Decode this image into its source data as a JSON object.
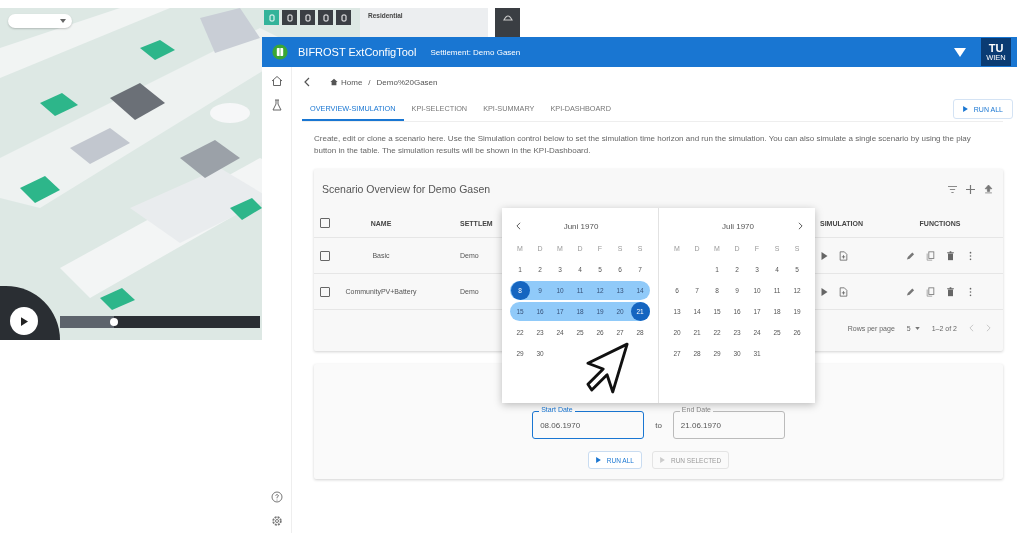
{
  "map": {
    "tools": [
      {
        "selected": true
      },
      {
        "selected": false
      },
      {
        "selected": false
      },
      {
        "selected": false
      },
      {
        "selected": false
      }
    ],
    "panel_title": "Residential",
    "timeline": {
      "level": 0.27
    }
  },
  "app": {
    "title": "BIFROST ExtConfigTool",
    "subtitle": "Settlement: Demo Gasen",
    "logo": {
      "top": "TU",
      "bottom": "WIEN"
    }
  },
  "breadcrumb": {
    "home": "Home",
    "separator": "/",
    "current": "Demo%20Gasen"
  },
  "tabs": [
    {
      "label": "OVERVIEW-SIMULATION",
      "selected": true
    },
    {
      "label": "KPI-SELECTION",
      "selected": false
    },
    {
      "label": "KPI-SUMMARY",
      "selected": false
    },
    {
      "label": "KPI-DASHBOARD",
      "selected": false
    }
  ],
  "run_all_button": "RUN ALL",
  "description": "Create, edit or clone a scenario here. Use the Simulation control below to set the simulation time horizon and run the simulation. You can also simulate a single scenario by using the play button in the table. The simulation results will be shown in the KPI-Dashboard.",
  "scenario_table": {
    "title": "Scenario Overview for Demo Gasen",
    "header_checked": false,
    "columns": [
      "NAME",
      "SETTLEM",
      "SIMULATION",
      "FUNCTIONS"
    ],
    "rows": [
      {
        "checked": false,
        "name": "Basic",
        "settlement": "Demo"
      },
      {
        "checked": false,
        "name": "CommunityPV+Battery",
        "settlement": "Demo"
      }
    ],
    "rows_per_page_label": "Rows per page",
    "rows_per_page": "5",
    "range": "1–2 of 2"
  },
  "simulation": {
    "start_date": {
      "label": "Start Date",
      "value": "08.06.1970",
      "focused": true
    },
    "separator": "to",
    "end_date": {
      "label": "End Date",
      "value": "21.06.1970",
      "focused": false
    },
    "buttons": [
      {
        "label": "RUN ALL",
        "disabled": false
      },
      {
        "label": "RUN SELECTED",
        "disabled": true
      }
    ]
  },
  "calendar": {
    "months": [
      {
        "title": "Juni 1970",
        "weekdays": [
          "M",
          "D",
          "M",
          "D",
          "F",
          "S",
          "S"
        ],
        "weeks": [
          {
            "days": [
              {
                "day": "1",
                "selected": false,
                "endpoint": false
              },
              {
                "day": "2",
                "selected": false,
                "endpoint": false
              },
              {
                "day": "3",
                "selected": false,
                "endpoint": false
              },
              {
                "day": "4",
                "selected": false,
                "endpoint": false
              },
              {
                "day": "5",
                "selected": false,
                "endpoint": false
              },
              {
                "day": "6",
                "selected": false,
                "endpoint": false
              },
              {
                "day": "7",
                "selected": false,
                "endpoint": false
              }
            ]
          },
          {
            "days": [
              {
                "day": "8",
                "selected": true,
                "endpoint": true
              },
              {
                "day": "9",
                "selected": true,
                "endpoint": false
              },
              {
                "day": "10",
                "selected": true,
                "endpoint": false
              },
              {
                "day": "11",
                "selected": true,
                "endpoint": false
              },
              {
                "day": "12",
                "selected": true,
                "endpoint": false
              },
              {
                "day": "13",
                "selected": true,
                "endpoint": false
              },
              {
                "day": "14",
                "selected": true,
                "endpoint": false
              }
            ]
          },
          {
            "days": [
              {
                "day": "15",
                "selected": true,
                "endpoint": false
              },
              {
                "day": "16",
                "selected": true,
                "endpoint": false
              },
              {
                "day": "17",
                "selected": true,
                "endpoint": false
              },
              {
                "day": "18",
                "selected": true,
                "endpoint": false
              },
              {
                "day": "19",
                "selected": true,
                "endpoint": false
              },
              {
                "day": "20",
                "selected": true,
                "endpoint": false
              },
              {
                "day": "21",
                "selected": true,
                "endpoint": true
              }
            ]
          },
          {
            "days": [
              {
                "day": "22",
                "selected": false,
                "endpoint": false
              },
              {
                "day": "23",
                "selected": false,
                "endpoint": false
              },
              {
                "day": "24",
                "selected": false,
                "endpoint": false
              },
              {
                "day": "25",
                "selected": false,
                "endpoint": false
              },
              {
                "day": "26",
                "selected": false,
                "endpoint": false
              },
              {
                "day": "27",
                "selected": false,
                "endpoint": false
              },
              {
                "day": "28",
                "selected": false,
                "endpoint": false
              }
            ]
          },
          {
            "days": [
              {
                "day": "29",
                "selected": false,
                "endpoint": false
              },
              {
                "day": "30",
                "selected": false,
                "endpoint": false
              }
            ]
          }
        ]
      },
      {
        "title": "Juli 1970",
        "weekdays": [
          "M",
          "D",
          "M",
          "D",
          "F",
          "S",
          "S"
        ],
        "weeks": [
          {
            "days": [
              {
                "day": "1",
                "selected": false,
                "endpoint": false
              },
              {
                "day": "2",
                "selected": false,
                "endpoint": false
              },
              {
                "day": "3",
                "selected": false,
                "endpoint": false
              },
              {
                "day": "4",
                "selected": false,
                "endpoint": false
              },
              {
                "day": "5",
                "selected": false,
                "endpoint": false
              }
            ]
          },
          {
            "days": [
              {
                "day": "6",
                "selected": false,
                "endpoint": false
              },
              {
                "day": "7",
                "selected": false,
                "endpoint": false
              },
              {
                "day": "8",
                "selected": false,
                "endpoint": false
              },
              {
                "day": "9",
                "selected": false,
                "endpoint": false
              },
              {
                "day": "10",
                "selected": false,
                "endpoint": false
              },
              {
                "day": "11",
                "selected": false,
                "endpoint": false
              },
              {
                "day": "12",
                "selected": false,
                "endpoint": false
              }
            ]
          },
          {
            "days": [
              {
                "day": "13",
                "selected": false,
                "endpoint": false
              },
              {
                "day": "14",
                "selected": false,
                "endpoint": false
              },
              {
                "day": "15",
                "selected": false,
                "endpoint": false
              },
              {
                "day": "16",
                "selected": false,
                "endpoint": false
              },
              {
                "day": "17",
                "selected": false,
                "endpoint": false
              },
              {
                "day": "18",
                "selected": false,
                "endpoint": false
              },
              {
                "day": "19",
                "selected": false,
                "endpoint": false
              }
            ]
          },
          {
            "days": [
              {
                "day": "20",
                "selected": false,
                "endpoint": false
              },
              {
                "day": "21",
                "selected": false,
                "endpoint": false
              },
              {
                "day": "22",
                "selected": false,
                "endpoint": false
              },
              {
                "day": "23",
                "selected": false,
                "endpoint": false
              },
              {
                "day": "24",
                "selected": false,
                "endpoint": false
              },
              {
                "day": "25",
                "selected": false,
                "endpoint": false
              },
              {
                "day": "26",
                "selected": false,
                "endpoint": false
              }
            ]
          },
          {
            "days": [
              {
                "day": "27",
                "selected": false,
                "endpoint": false
              },
              {
                "day": "28",
                "selected": false,
                "endpoint": false
              },
              {
                "day": "29",
                "selected": false,
                "endpoint": false
              },
              {
                "day": "30",
                "selected": false,
                "endpoint": false
              },
              {
                "day": "31",
                "selected": false,
                "endpoint": false
              }
            ]
          }
        ]
      }
    ]
  }
}
